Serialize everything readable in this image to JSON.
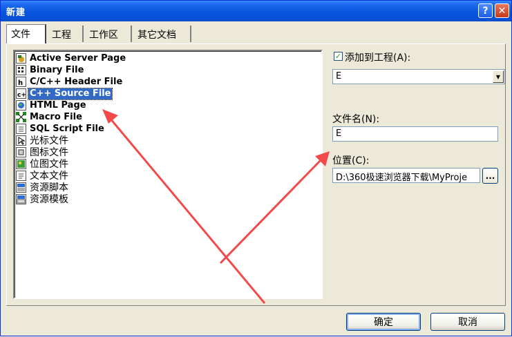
{
  "window": {
    "title": "新建",
    "help_symbol": "?",
    "close_symbol": "✕"
  },
  "tabs": [
    {
      "label": "文件",
      "active": true
    },
    {
      "label": "工程",
      "active": false
    },
    {
      "label": "工作区",
      "active": false
    },
    {
      "label": "其它文档",
      "active": false
    }
  ],
  "file_types": [
    {
      "label": "Active Server Page",
      "icon": "asp-file-icon"
    },
    {
      "label": "Binary File",
      "icon": "binary-file-icon"
    },
    {
      "label": "C/C++ Header File",
      "icon": "header-file-icon"
    },
    {
      "label": "C++ Source File",
      "icon": "cpp-file-icon",
      "selected": true
    },
    {
      "label": "HTML Page",
      "icon": "html-file-icon"
    },
    {
      "label": "Macro File",
      "icon": "macro-file-icon"
    },
    {
      "label": "SQL Script File",
      "icon": "sql-file-icon"
    },
    {
      "label": "光标文件",
      "icon": "cursor-file-icon"
    },
    {
      "label": "图标文件",
      "icon": "icon-file-icon"
    },
    {
      "label": "位图文件",
      "icon": "bitmap-file-icon"
    },
    {
      "label": "文本文件",
      "icon": "text-file-icon"
    },
    {
      "label": "资源脚本",
      "icon": "resource-script-icon"
    },
    {
      "label": "资源模板",
      "icon": "resource-template-icon"
    }
  ],
  "add_to_project": {
    "checked": true,
    "label": "添加到工程(A):",
    "selected_value": "E"
  },
  "filename": {
    "label": "文件名(N):",
    "value": "E"
  },
  "location": {
    "label": "位置(C):",
    "value": "D:\\360极速浏览器下载\\MyProje",
    "browse_label": "..."
  },
  "buttons": {
    "ok": "确定",
    "cancel": "取消"
  },
  "colors": {
    "selection": "#316ac5",
    "annotation_arrow": "#f04a4a",
    "titlebar": "#0a58de"
  }
}
